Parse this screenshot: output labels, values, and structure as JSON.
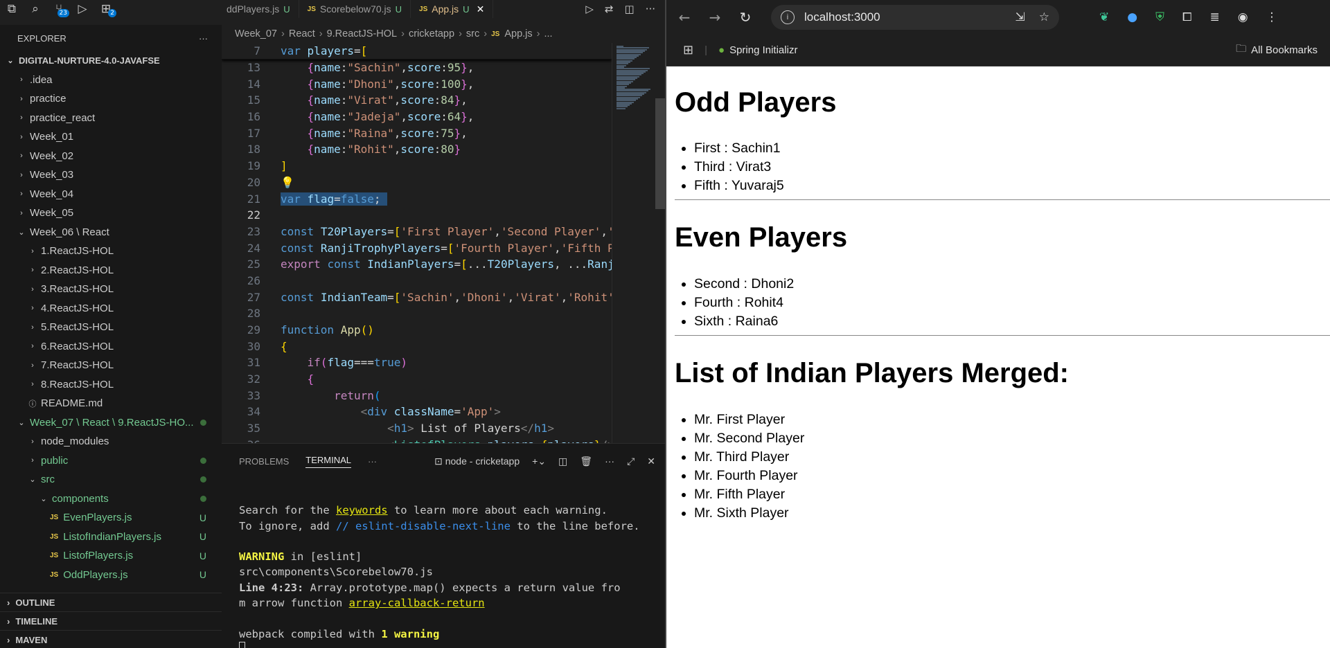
{
  "vscode": {
    "activity": {
      "ext_badge": "23",
      "scm_badge": "2"
    },
    "tabs": [
      {
        "label": "ddPlayers.js",
        "status": "U",
        "active": false
      },
      {
        "label": "Scorebelow70.js",
        "status": "U",
        "active": false
      },
      {
        "label": "App.js",
        "status": "U",
        "active": true
      }
    ],
    "breadcrumbs": [
      "Week_07",
      "React",
      "9.ReactJS-HOL",
      "cricketapp",
      "src",
      "App.js",
      "..."
    ],
    "explorer": {
      "title": "EXPLORER",
      "more": "···",
      "root": "DIGITAL-NURTURE-4.0-JAVAFSE",
      "items": [
        {
          "label": ".idea",
          "indent": 1,
          "chev": "›"
        },
        {
          "label": "practice",
          "indent": 1,
          "chev": "›"
        },
        {
          "label": "practice_react",
          "indent": 1,
          "chev": "›"
        },
        {
          "label": "Week_01",
          "indent": 1,
          "chev": "›"
        },
        {
          "label": "Week_02",
          "indent": 1,
          "chev": "›"
        },
        {
          "label": "Week_03",
          "indent": 1,
          "chev": "›"
        },
        {
          "label": "Week_04",
          "indent": 1,
          "chev": "›"
        },
        {
          "label": "Week_05",
          "indent": 1,
          "chev": "›"
        },
        {
          "label": "Week_06 \\ React",
          "indent": 1,
          "chev": "⌄"
        },
        {
          "label": "1.ReactJS-HOL",
          "indent": 2,
          "chev": "›"
        },
        {
          "label": "2.ReactJS-HOL",
          "indent": 2,
          "chev": "›"
        },
        {
          "label": "3.ReactJS-HOL",
          "indent": 2,
          "chev": "›"
        },
        {
          "label": "4.ReactJS-HOL",
          "indent": 2,
          "chev": "›"
        },
        {
          "label": "5.ReactJS-HOL",
          "indent": 2,
          "chev": "›"
        },
        {
          "label": "6.ReactJS-HOL",
          "indent": 2,
          "chev": "›"
        },
        {
          "label": "7.ReactJS-HOL",
          "indent": 2,
          "chev": "›"
        },
        {
          "label": "8.ReactJS-HOL",
          "indent": 2,
          "chev": "›"
        },
        {
          "label": "README.md",
          "indent": 2,
          "chev": "ⓘ"
        },
        {
          "label": "Week_07 \\ React \\ 9.ReactJS-HO...",
          "indent": 1,
          "chev": "⌄",
          "green": true,
          "dot": true
        },
        {
          "label": "node_modules",
          "indent": 2,
          "chev": "›"
        },
        {
          "label": "public",
          "indent": 2,
          "chev": "›",
          "green": true,
          "dot": true
        },
        {
          "label": "src",
          "indent": 2,
          "chev": "⌄",
          "green": true,
          "dot": true
        },
        {
          "label": "components",
          "indent": 3,
          "chev": "⌄",
          "green": true,
          "dot": true
        },
        {
          "label": "EvenPlayers.js",
          "indent": 4,
          "js": true,
          "green": true,
          "u": "U"
        },
        {
          "label": "ListofIndianPlayers.js",
          "indent": 4,
          "js": true,
          "green": true,
          "u": "U"
        },
        {
          "label": "ListofPlayers.js",
          "indent": 4,
          "js": true,
          "green": true,
          "u": "U"
        },
        {
          "label": "OddPlayers.js",
          "indent": 4,
          "js": true,
          "green": true,
          "u": "U"
        }
      ],
      "sections": [
        "OUTLINE",
        "TIMELINE",
        "MAVEN"
      ]
    },
    "editor": {
      "lines": [
        {
          "n": "7",
          "html": "<span class='kw'>var</span> <span class='var'>players</span><span class='tx'>=</span><span class='br'>[</span>"
        },
        {
          "n": "13",
          "html": "    <span class='br2'>{</span><span class='var'>name</span><span class='tx'>:</span><span class='str'>\"Sachin\"</span><span class='tx'>,</span><span class='var'>score</span><span class='tx'>:</span><span class='num'>95</span><span class='br2'>}</span><span class='tx'>,</span>"
        },
        {
          "n": "14",
          "html": "    <span class='br2'>{</span><span class='var'>name</span><span class='tx'>:</span><span class='str'>\"Dhoni\"</span><span class='tx'>,</span><span class='var'>score</span><span class='tx'>:</span><span class='num'>100</span><span class='br2'>}</span><span class='tx'>,</span>"
        },
        {
          "n": "15",
          "html": "    <span class='br2'>{</span><span class='var'>name</span><span class='tx'>:</span><span class='str'>\"Virat\"</span><span class='tx'>,</span><span class='var'>score</span><span class='tx'>:</span><span class='num'>84</span><span class='br2'>}</span><span class='tx'>,</span>"
        },
        {
          "n": "16",
          "html": "    <span class='br2'>{</span><span class='var'>name</span><span class='tx'>:</span><span class='str'>\"Jadeja\"</span><span class='tx'>,</span><span class='var'>score</span><span class='tx'>:</span><span class='num'>64</span><span class='br2'>}</span><span class='tx'>,</span>"
        },
        {
          "n": "17",
          "html": "    <span class='br2'>{</span><span class='var'>name</span><span class='tx'>:</span><span class='str'>\"Raina\"</span><span class='tx'>,</span><span class='var'>score</span><span class='tx'>:</span><span class='num'>75</span><span class='br2'>}</span><span class='tx'>,</span>"
        },
        {
          "n": "18",
          "html": "    <span class='br2'>{</span><span class='var'>name</span><span class='tx'>:</span><span class='str'>\"Rohit\"</span><span class='tx'>,</span><span class='var'>score</span><span class='tx'>:</span><span class='num'>80</span><span class='br2'>}</span>"
        },
        {
          "n": "19",
          "html": "<span class='br'>]</span>"
        },
        {
          "n": "20",
          "html": "<span class='br'>💡</span>"
        },
        {
          "n": "21",
          "html": "<span class='sel'><span class='kw'>var</span> <span class='var'>flag</span><span class='tx'>=</span><span class='kw'>false</span><span class='tx'>; </span></span>"
        },
        {
          "n": "22",
          "html": "",
          "cur": true
        },
        {
          "n": "23",
          "html": "<span class='kw'>const</span> <span class='var'>T20Players</span><span class='tx'>=</span><span class='br'>[</span><span class='str'>'First Player'</span><span class='tx'>,</span><span class='str'>'Second Player'</span><span class='tx'>,</span><span class='str'>'</span>"
        },
        {
          "n": "24",
          "html": "<span class='kw'>const</span> <span class='var'>RanjiTrophyPlayers</span><span class='tx'>=</span><span class='br'>[</span><span class='str'>'Fourth Player'</span><span class='tx'>,</span><span class='str'>'Fifth P</span>"
        },
        {
          "n": "25",
          "html": "<span class='k2'>export</span> <span class='kw'>const</span> <span class='var'>IndianPlayers</span><span class='tx'>=</span><span class='br'>[</span><span class='tx'>...</span><span class='var'>T20Players</span><span class='tx'>, ...</span><span class='var'>Ranj</span>"
        },
        {
          "n": "26",
          "html": ""
        },
        {
          "n": "27",
          "html": "<span class='kw'>const</span> <span class='var'>IndianTeam</span><span class='tx'>=</span><span class='br'>[</span><span class='str'>'Sachin'</span><span class='tx'>,</span><span class='str'>'Dhoni'</span><span class='tx'>,</span><span class='str'>'Virat'</span><span class='tx'>,</span><span class='str'>'Rohit'</span>"
        },
        {
          "n": "28",
          "html": ""
        },
        {
          "n": "29",
          "html": "<span class='kw'>function</span> <span class='fn'>App</span><span class='br'>()</span>"
        },
        {
          "n": "30",
          "html": "<span class='br'>{</span>"
        },
        {
          "n": "31",
          "html": "    <span class='k2'>if</span><span class='br2'>(</span><span class='var'>flag</span><span class='tx'>===</span><span class='kw'>true</span><span class='br2'>)</span>"
        },
        {
          "n": "32",
          "html": "    <span class='br2'>{</span>"
        },
        {
          "n": "33",
          "html": "        <span class='k2'>return</span><span class='br3'>(</span>"
        },
        {
          "n": "34",
          "html": "            <span class='pl'>&lt;</span><span class='tag'>div</span> <span class='var'>className</span><span class='tx'>=</span><span class='str'>'App'</span><span class='pl'>&gt;</span>"
        },
        {
          "n": "35",
          "html": "                <span class='pl'>&lt;</span><span class='tag'>h1</span><span class='pl'>&gt;</span><span class='tx'> List of Players</span><span class='pl'>&lt;/</span><span class='tag'>h1</span><span class='pl'>&gt;</span>"
        },
        {
          "n": "36",
          "html": "                <span class='pl'>&lt;</span><span class='cmp'>ListofPlayers</span> <span class='var'>players</span><span class='tx'>=</span><span class='br'>{</span><span class='var'>players</span><span class='br'>}</span><span class='pl'>/&gt;</span>"
        }
      ]
    },
    "panel": {
      "tabs": [
        "PROBLEMS",
        "TERMINAL"
      ],
      "active": "TERMINAL",
      "more": "···",
      "terminal_name": "node - cricketapp",
      "term_lines": [
        {
          "html": ""
        },
        {
          "html": "Search for the <span class='yl'>keywords</span> to learn more about each warning."
        },
        {
          "html": "To ignore, add <span class='bl'>// eslint-disable-next-line</span> to the line before."
        },
        {
          "html": ""
        },
        {
          "html": "<span class='wy'>WARNING</span> in [eslint]"
        },
        {
          "html": "src\\components\\Scorebelow70.js"
        },
        {
          "html": "  <span class='bd'>Line 4:23:</span>  Array.prototype.map() expects a return value fro"
        },
        {
          "html": "m arrow function  <span class='yl'>array-callback-return</span>"
        },
        {
          "html": ""
        },
        {
          "html": "webpack compiled with <span class='wy'>1 warning</span>"
        }
      ]
    }
  },
  "browser": {
    "url": "localhost:3000",
    "bookmarks": {
      "item": "Spring Initializr",
      "all": "All Bookmarks"
    },
    "page": {
      "odd_title": "Odd Players",
      "odd": [
        "First : Sachin1",
        "Third : Virat3",
        "Fifth : Yuvaraj5"
      ],
      "even_title": "Even Players",
      "even": [
        "Second : Dhoni2",
        "Fourth : Rohit4",
        "Sixth : Raina6"
      ],
      "merged_title": "List of Indian Players Merged:",
      "merged": [
        "Mr. First Player",
        "Mr. Second Player",
        "Mr. Third Player",
        "Mr. Fourth Player",
        "Mr. Fifth Player",
        "Mr. Sixth Player"
      ]
    }
  },
  "colors": {
    "accent": "#0078d4",
    "git_untracked": "#73c991",
    "js_icon": "#e8c84a"
  }
}
